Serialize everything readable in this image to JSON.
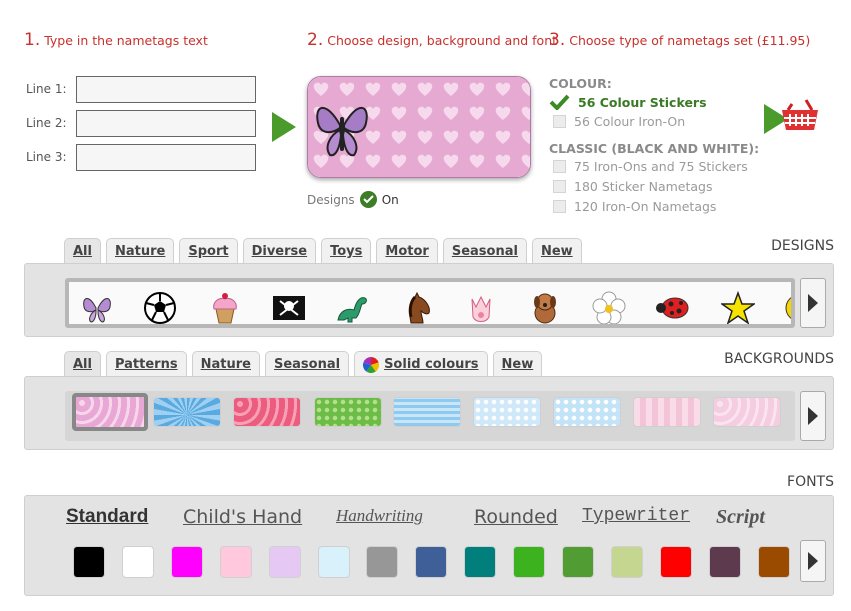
{
  "steps": [
    {
      "num": "1.",
      "text": "Type in the nametags text"
    },
    {
      "num": "2.",
      "text": "Choose design, background and font"
    },
    {
      "num": "3.",
      "text": "Choose type of nametags set (£11.95)"
    }
  ],
  "lines": [
    {
      "label": "Line 1:",
      "value": ""
    },
    {
      "label": "Line 2:",
      "value": ""
    },
    {
      "label": "Line 3:",
      "value": ""
    }
  ],
  "designs_toggle": {
    "label": "Designs",
    "state": "On"
  },
  "options": {
    "colour_heading": "COLOUR:",
    "colour_items": [
      "56 Colour Stickers",
      "56 Colour Iron-On"
    ],
    "classic_heading": "CLASSIC (BLACK AND WHITE):",
    "classic_items": [
      "75 Iron-Ons and 75 Stickers",
      "180 Sticker Nametags",
      "120 Iron-On Nametags"
    ],
    "selected": "56 Colour Stickers"
  },
  "designs": {
    "title": "DESIGNS",
    "tabs": [
      "All",
      "Nature",
      "Sport",
      "Diverse",
      "Toys",
      "Motor",
      "Seasonal",
      "New"
    ],
    "active_tab": "All",
    "icons": [
      "butterfly-icon",
      "football-icon",
      "cupcake-icon",
      "pirate-flag-icon",
      "dinosaur-icon",
      "horse-icon",
      "crown-icon",
      "puppy-icon",
      "flower-icon",
      "ladybird-icon",
      "star-icon",
      "smiley-icon"
    ]
  },
  "backgrounds": {
    "title": "BACKGROUNDS",
    "tabs": [
      "All",
      "Patterns",
      "Nature",
      "Seasonal",
      "Solid colours",
      "New"
    ],
    "active_tab": "All",
    "swatches": [
      "pink-hearts",
      "blue-sunburst",
      "red-hearts",
      "green-dots",
      "blue-waves",
      "blue-dots",
      "light-blue-dots",
      "pink-stripes",
      "pink-light-hearts"
    ]
  },
  "fonts": {
    "title": "FONTS",
    "names": [
      "Standard",
      "Child's Hand",
      "Handwriting",
      "Rounded",
      "Typewriter",
      "Script"
    ],
    "selected": "Standard",
    "colors": [
      "#000000",
      "#ffffff",
      "#ff00ff",
      "#ffc8dc",
      "#e6c8f5",
      "#d8f1fb",
      "#979797",
      "#3f5f98",
      "#007f7c",
      "#3bb21e",
      "#519c33",
      "#c4d690",
      "#ff0000",
      "#5e3a4f",
      "#9b4b00"
    ]
  }
}
